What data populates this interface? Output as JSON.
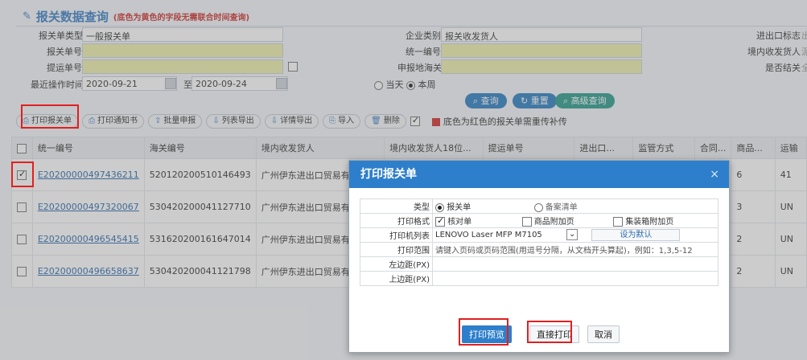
{
  "page_title": "报关数据查询",
  "page_note": "(底色为黄色的字段无需联合时间查询)",
  "search": {
    "decl_type_label": "报关单类型",
    "decl_type_value": "一般报关单",
    "enterprise_type_label": "企业类别",
    "enterprise_type_value": "报关收发货人",
    "ie_flag_label": "进出口标志",
    "ie_flag_value": "出",
    "decl_no_label": "报关单号",
    "unified_no_label": "统一编号",
    "domestic_label": "境内收发货人",
    "domestic_value": "泥",
    "bl_no_label": "提运单号",
    "customs_label": "申报地海关",
    "is_bonded_label": "是否结关",
    "is_bonded_value": "全",
    "last_op_label": "最近操作时间",
    "date_from": "2020-09-21",
    "date_to_label": "至",
    "date_to": "2020-09-24",
    "today_label": "当天",
    "week_label": "本周",
    "query_button": "查询",
    "reset_button": "重置",
    "advanced_button": "高级查询"
  },
  "toolbar": {
    "print_decl": "打印报关单",
    "print_notice": "打印通知书",
    "batch_declare": "批量申报",
    "list_export": "列表导出",
    "detail_export": "详情导出",
    "import": "导入",
    "delete": "删除",
    "legend_text": "底色为红色的报关单需重传补传"
  },
  "table": {
    "headers": [
      "统一编号",
      "海关编号",
      "境内收发货人",
      "境内收发货人18位...",
      "提运单号",
      "进出口...",
      "监管方式",
      "合同...",
      "商品...",
      "运输"
    ],
    "rows": [
      {
        "no": "E20200000497436211",
        "customs_no": "520120200510146493",
        "consignee": "广州伊东进出口贸易有限公司",
        "goods": "6",
        "trans": "41"
      },
      {
        "no": "E20200000497320067",
        "customs_no": "530420200041127710",
        "consignee": "广州伊东进出口贸易有限公司",
        "goods": "3",
        "trans": "UN"
      },
      {
        "no": "E20200000496545415",
        "customs_no": "531620200161647014",
        "consignee": "广州伊东进出口贸易有限公司",
        "goods": "2",
        "trans": "UN"
      },
      {
        "no": "E20200000496658637",
        "customs_no": "530420200041121798",
        "consignee": "广州伊东进出口贸易有限公司",
        "goods": "2",
        "trans": "UN"
      }
    ]
  },
  "dialog": {
    "title": "打印报关单",
    "close": "×",
    "type_label": "类型",
    "type_opt1": "报关单",
    "type_opt2": "备案清单",
    "format_label": "打印格式",
    "format_opt1": "核对单",
    "format_opt2": "商品附加页",
    "format_opt3": "集装箱附加页",
    "printer_label": "打印机列表",
    "printer_value": "LENOVO Laser MFP M7105",
    "set_default": "设为默认",
    "range_label": "打印范围",
    "range_hint": "请键入页码或页码范围(用逗号分隔，从文档开头算起)，例如：1,3,5-12",
    "left_margin_label": "左边距(PX)",
    "top_margin_label": "上边距(PX)",
    "preview_button": "打印预览",
    "direct_print_button": "直接打印",
    "cancel_button": "取消"
  },
  "colors": {
    "accent": "#2e7fcb",
    "highlight_box": "#e02020",
    "yellow_field": "#eef2ae"
  }
}
